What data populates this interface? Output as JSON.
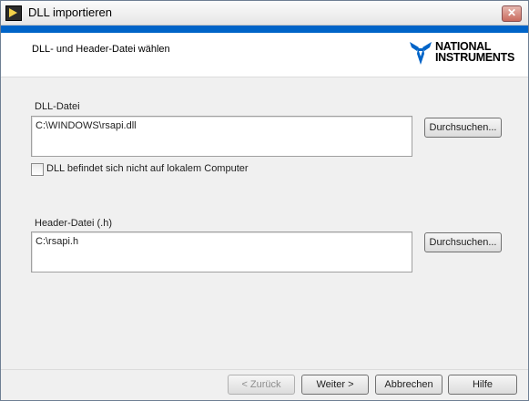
{
  "window": {
    "title": "DLL importieren"
  },
  "header": {
    "step_title": "DLL- und Header-Datei wählen",
    "logo_line1": "NATIONAL",
    "logo_line2": "INSTRUMENTS"
  },
  "dll": {
    "label": "DLL-Datei",
    "value": "C:\\WINDOWS\\rsapi.dll",
    "browse_label": "Durchsuchen..."
  },
  "checkbox": {
    "label": "DLL befindet sich nicht auf lokalem Computer",
    "checked": false
  },
  "header_file": {
    "label": "Header-Datei (.h)",
    "value": "C:\\rsapi.h",
    "browse_label": "Durchsuchen..."
  },
  "footer": {
    "back_label": "< Zurück",
    "next_label": "Weiter >",
    "cancel_label": "Abbrechen",
    "help_label": "Hilfe"
  },
  "icons": {
    "app": "labview-icon",
    "close": "close-icon",
    "logo": "national-instruments-eagle-logo"
  },
  "colors": {
    "accent_band": "#0064c8",
    "close_button": "#c96b5e"
  }
}
